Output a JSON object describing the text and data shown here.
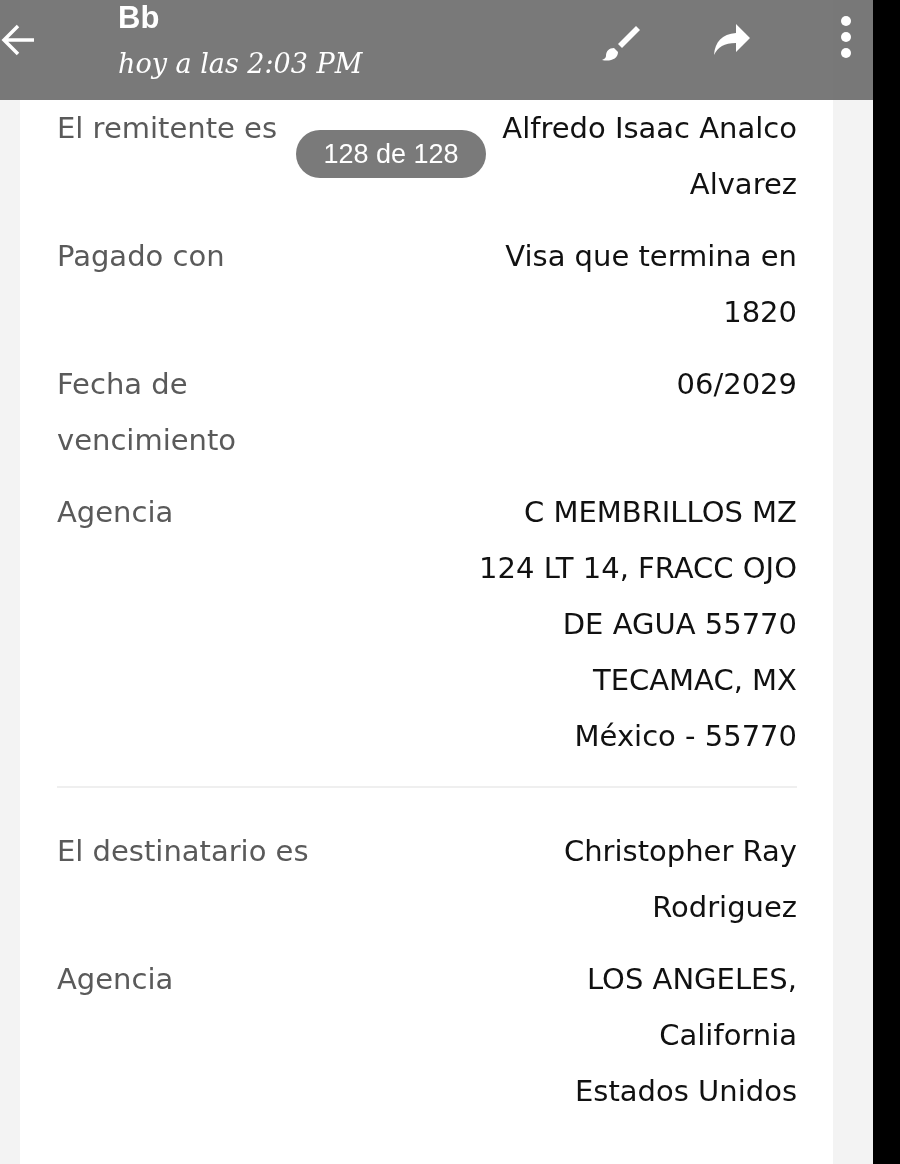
{
  "header": {
    "title": "Bb",
    "subtitle": "hoy a las 2:03 PM"
  },
  "counter": "128 de 128",
  "sections": [
    {
      "rows": [
        {
          "label": "El remitente es",
          "lines": [
            "Alfredo Isaac Analco Alvarez"
          ]
        },
        {
          "label": "Pagado con",
          "lines": [
            "Visa que termina en 1820"
          ]
        },
        {
          "label": "Fecha de vencimiento",
          "lines": [
            "06/2029"
          ]
        },
        {
          "label": "Agencia",
          "lines": [
            "C MEMBRILLOS MZ 124 LT 14, FRACC OJO DE AGUA 55770 TECAMAC, MX",
            "México - 55770"
          ]
        }
      ]
    },
    {
      "rows": [
        {
          "label": "El destinatario es",
          "lines": [
            "Christopher Ray Rodriguez"
          ]
        },
        {
          "label": "Agencia",
          "lines": [
            "LOS ANGELES, California",
            "Estados Unidos"
          ]
        }
      ]
    }
  ]
}
